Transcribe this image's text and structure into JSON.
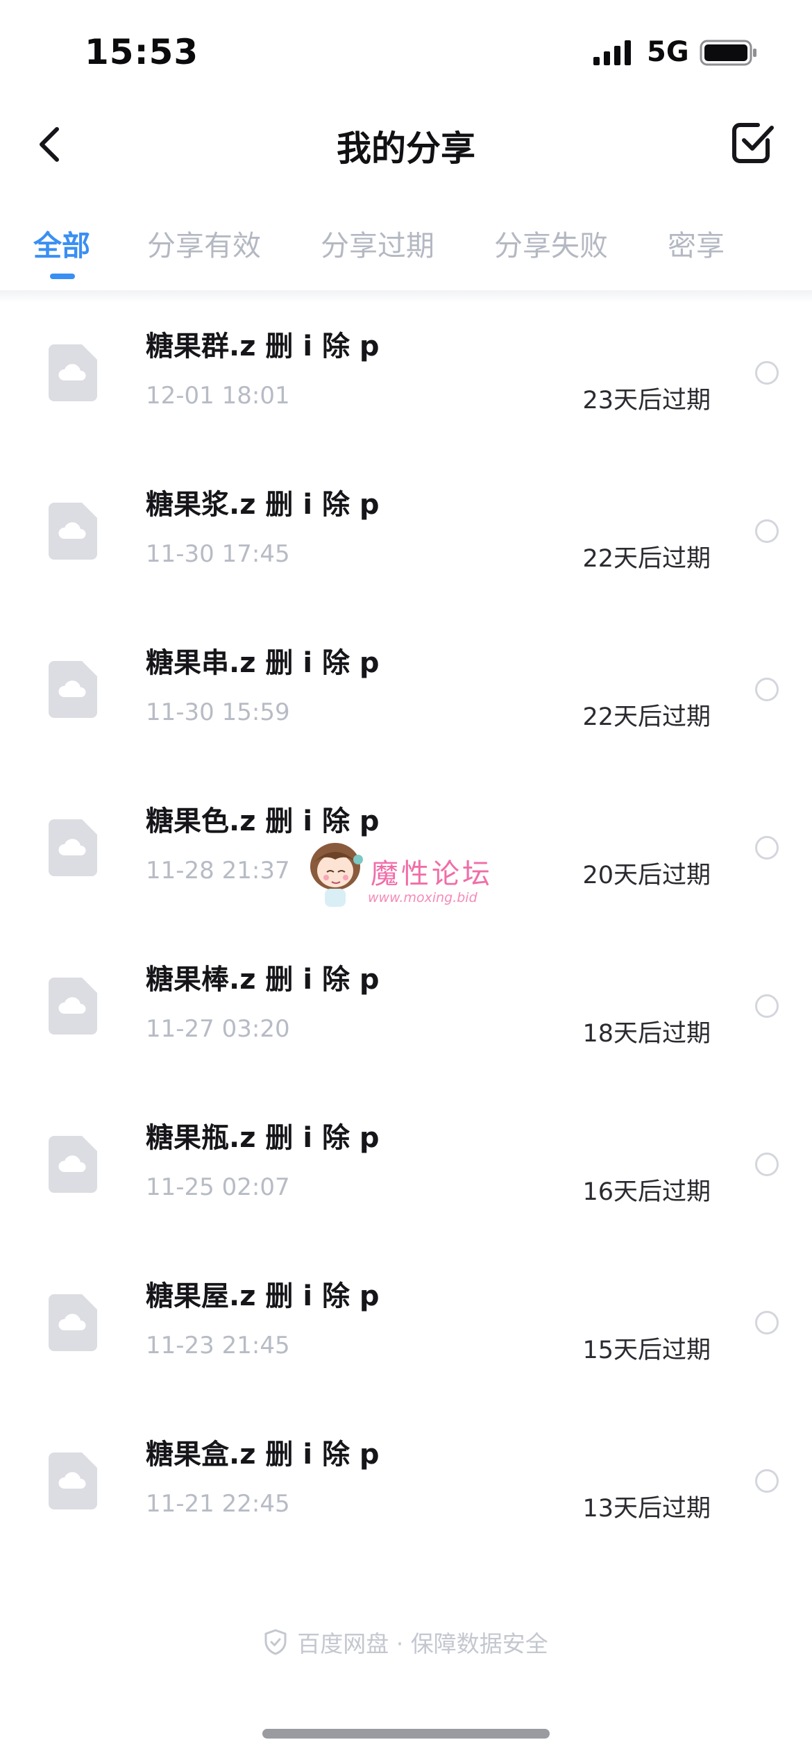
{
  "status_bar": {
    "time": "15:53",
    "network": "5G"
  },
  "nav": {
    "title": "我的分享",
    "back_icon": "chevron-left-icon",
    "select_icon": "checkbox-square-icon"
  },
  "tabs": [
    {
      "label": "全部",
      "active": true
    },
    {
      "label": "分享有效",
      "active": false
    },
    {
      "label": "分享过期",
      "active": false
    },
    {
      "label": "分享失败",
      "active": false
    },
    {
      "label": "密享",
      "active": false
    }
  ],
  "shares": [
    {
      "name": "糖果群.z 删 i 除 p",
      "date": "12-01 18:01",
      "expire": "23天后过期"
    },
    {
      "name": "糖果浆.z 删 i 除 p",
      "date": "11-30 17:45",
      "expire": "22天后过期"
    },
    {
      "name": "糖果串.z 删 i 除 p",
      "date": "11-30 15:59",
      "expire": "22天后过期"
    },
    {
      "name": "糖果色.z 删 i 除 p",
      "date": "11-28 21:37",
      "expire": "20天后过期"
    },
    {
      "name": "糖果棒.z 删 i 除 p",
      "date": "11-27 03:20",
      "expire": "18天后过期"
    },
    {
      "name": "糖果瓶.z 删 i 除 p",
      "date": "11-25 02:07",
      "expire": "16天后过期"
    },
    {
      "name": "糖果屋.z 删 i 除 p",
      "date": "11-23 21:45",
      "expire": "15天后过期"
    },
    {
      "name": "糖果盒.z 删 i 除 p",
      "date": "11-21 22:45",
      "expire": "13天后过期"
    }
  ],
  "watermark": {
    "title": "魔性论坛",
    "url": "www.moxing.bid"
  },
  "footer": {
    "text": "百度网盘 · 保障数据安全",
    "icon": "shield-check-icon"
  },
  "colors": {
    "accent": "#3a8ff2",
    "muted_text": "#b7bbc5",
    "file_icon": "#dcdde2"
  }
}
